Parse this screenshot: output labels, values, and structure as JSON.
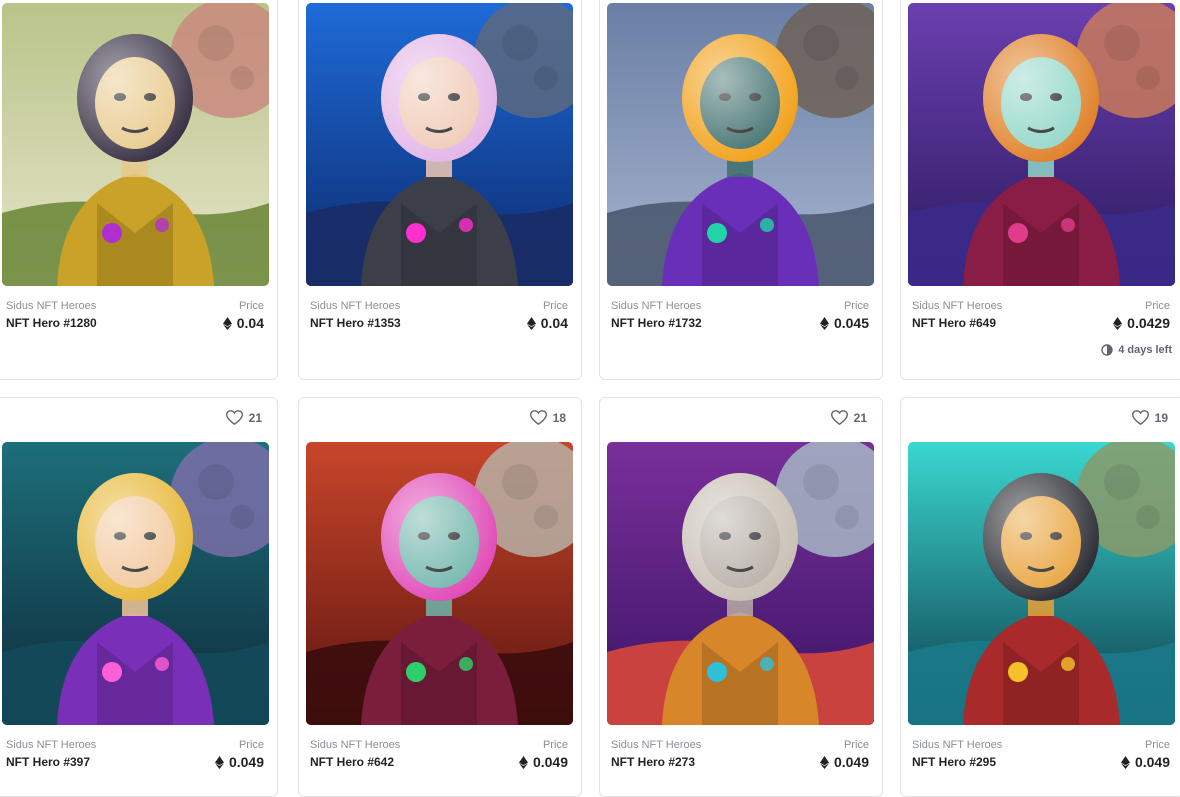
{
  "cards": [
    {
      "collection": "Sidus NFT Heroes",
      "name": "NFT Hero #1280",
      "price_label": "Price",
      "price": "0.04",
      "palette": {
        "bg1": "#e6e4c8",
        "bg2": "#b9c48a",
        "planet": "#c98a7e",
        "ground": "#6f8a3c",
        "helmet": "#3a3346",
        "suit": "#c9a227",
        "face": "#e8c98a",
        "accent": "#b12fd1"
      }
    },
    {
      "collection": "Sidus NFT Heroes",
      "name": "NFT Hero #1353",
      "price_label": "Price",
      "price": "0.04",
      "palette": {
        "bg1": "#0b2a6e",
        "bg2": "#1e6bd8",
        "planet": "#5c6a80",
        "ground": "#1a2c66",
        "helmet": "#e3b7e8",
        "suit": "#3c3f4a",
        "face": "#f0c9b5",
        "accent": "#ff2fd0"
      }
    },
    {
      "collection": "Sidus NFT Heroes",
      "name": "NFT Hero #1732",
      "price_label": "Price",
      "price": "0.045",
      "palette": {
        "bg1": "#a7b5cf",
        "bg2": "#6a7fa6",
        "planet": "#6f6258",
        "ground": "#4b5970",
        "helmet": "#f2a21c",
        "suit": "#6a2fb8",
        "face": "#3e6e6c",
        "accent": "#22d3a8"
      }
    },
    {
      "collection": "Sidus NFT Heroes",
      "name": "NFT Hero #649",
      "price_label": "Price",
      "price": "0.0429",
      "time_left": "4 days left",
      "palette": {
        "bg1": "#2b1a5e",
        "bg2": "#6b3fb0",
        "planet": "#c97a5a",
        "ground": "#3b2a8a",
        "helmet": "#e0822a",
        "suit": "#8a1d45",
        "face": "#8fd6c8",
        "accent": "#e03c8a"
      }
    },
    {
      "likes": "21",
      "collection": "Sidus NFT Heroes",
      "name": "NFT Hero #397",
      "price_label": "Price",
      "price": "0.049",
      "palette": {
        "bg1": "#0f2a3a",
        "bg2": "#1c6f7a",
        "planet": "#7a6ea8",
        "ground": "#134a5a",
        "helmet": "#e8b93a",
        "suit": "#7a2fb8",
        "face": "#f2c79a",
        "accent": "#ff5fd6"
      }
    },
    {
      "likes": "18",
      "collection": "Sidus NFT Heroes",
      "name": "NFT Hero #642",
      "price_label": "Price",
      "price": "0.049",
      "palette": {
        "bg1": "#5c1410",
        "bg2": "#c8462a",
        "planet": "#b7b0a6",
        "ground": "#3a0c0c",
        "helmet": "#e04cb8",
        "suit": "#7a1e3c",
        "face": "#6fb5aa",
        "accent": "#2fd06a"
      }
    },
    {
      "likes": "21",
      "collection": "Sidus NFT Heroes",
      "name": "NFT Hero #273",
      "price_label": "Price",
      "price": "0.049",
      "palette": {
        "bg1": "#3a1466",
        "bg2": "#7a2f9a",
        "planet": "#a6b7c4",
        "ground": "#d8473a",
        "helmet": "#c9c0b5",
        "suit": "#d8862a",
        "face": "#b7aea5",
        "accent": "#2fc0d8"
      }
    },
    {
      "likes": "19",
      "collection": "Sidus NFT Heroes",
      "name": "NFT Hero #295",
      "price_label": "Price",
      "price": "0.049",
      "palette": {
        "bg1": "#0e3a4a",
        "bg2": "#3ad8d0",
        "planet": "#8a9a6a",
        "ground": "#1a7a8a",
        "helmet": "#2e2f36",
        "suit": "#a82a2a",
        "face": "#e8a23a",
        "accent": "#f5c02a"
      }
    }
  ]
}
